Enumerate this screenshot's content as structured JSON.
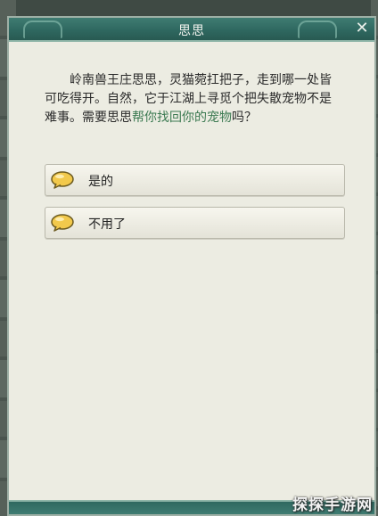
{
  "dialog": {
    "title": "思思",
    "close_symbol": "✕"
  },
  "message": {
    "text_part1": "岭南兽王庄思思，灵猫菀扛把子，走到哪一处皆可吃得开。自然，它于江湖上寻觅个把失散宠物不是难事。需要思思",
    "highlight": "帮你找回你的宠物",
    "text_part2": "吗？"
  },
  "options": [
    {
      "label": "是的",
      "icon": "speech-bubble-icon"
    },
    {
      "label": "不用了",
      "icon": "speech-bubble-icon"
    }
  ],
  "watermark": "探探手游网",
  "colors": {
    "title_bar": "#2f6860",
    "panel_bg": "#ecece2",
    "highlight_text": "#3c7a52",
    "bubble_fill": "#f2c94c"
  }
}
